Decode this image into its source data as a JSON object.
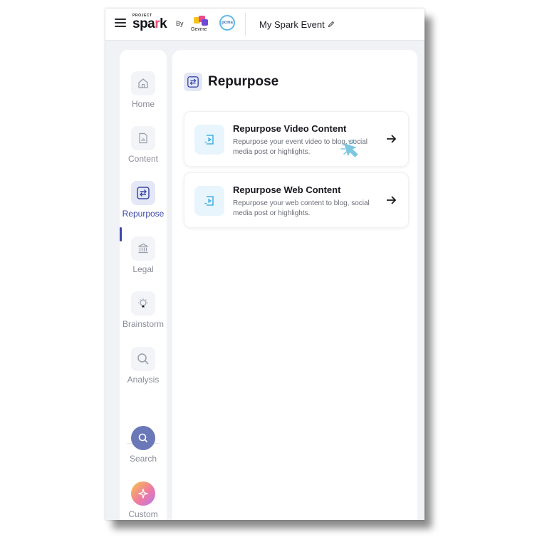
{
  "header": {
    "logo_small": "PROJECT",
    "logo_word_a": "spa",
    "logo_word_r": "r",
    "logo_word_b": "k",
    "by_label": "By",
    "partner1": "Gevme",
    "partner2": "pcma",
    "event_title": "My Spark Event",
    "icons": [
      "hamburger-menu-icon",
      "pencil-icon"
    ]
  },
  "sidebar": {
    "items": [
      {
        "label": "Home",
        "icon": "home-icon"
      },
      {
        "label": "Content",
        "icon": "document-chart-icon"
      },
      {
        "label": "Repurpose",
        "icon": "repurpose-arrows-icon",
        "active": true
      },
      {
        "label": "Legal",
        "icon": "bank-icon"
      },
      {
        "label": "Brainstorm",
        "icon": "lightbulb-icon"
      },
      {
        "label": "Analysis",
        "icon": "magnifier-icon"
      }
    ],
    "tools": [
      {
        "label": "Search",
        "icon": "search-icon"
      },
      {
        "label": "Custom task",
        "icon": "sparkle-icon"
      }
    ]
  },
  "main": {
    "title": "Repurpose",
    "cards": [
      {
        "title": "Repurpose Video Content",
        "description": "Repurpose your event video to blog, social media post or highlights."
      },
      {
        "title": "Repurpose Web Content",
        "description": "Repurpose your web content to blog, social media post or highlights."
      }
    ]
  },
  "colors": {
    "accent": "#3b4aa9",
    "active_bg": "#e4e7f6",
    "card_icon_bg": "#e8f5fd",
    "card_icon_fg": "#2aa3e0",
    "cursor": "#7cc6e0",
    "search_bg": "#6a78b8"
  }
}
